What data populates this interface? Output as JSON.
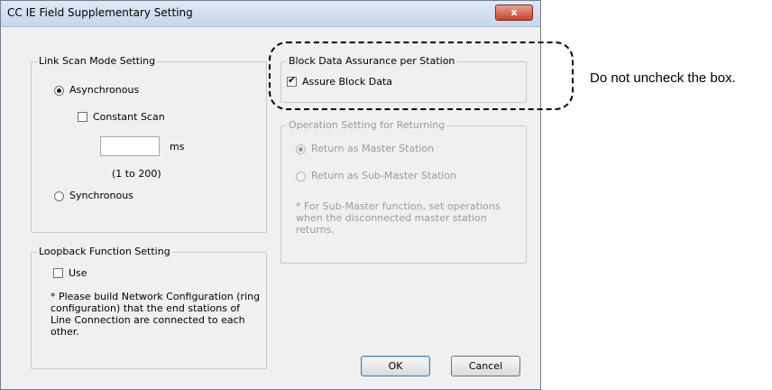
{
  "window": {
    "title": "CC IE Field Supplementary Setting",
    "close_label": "x"
  },
  "link_scan": {
    "legend": "Link Scan Mode Setting",
    "asynchronous_label": "Asynchronous",
    "asynchronous_selected": true,
    "constant_scan_label": "Constant Scan",
    "constant_scan_checked": false,
    "ms_value": "",
    "ms_unit": "ms",
    "range_hint": "(1 to 200)",
    "synchronous_label": "Synchronous"
  },
  "loopback": {
    "legend": "Loopback Function Setting",
    "use_label": "Use",
    "use_checked": false,
    "note": "* Please build Network Configuration (ring configuration) that the end stations of Line Connection are connected to each other."
  },
  "block_data": {
    "legend": "Block Data Assurance per Station",
    "assure_label": "Assure Block Data",
    "assure_checked": true
  },
  "operation_return": {
    "legend": "Operation Setting for Returning",
    "master_label": "Return as Master Station",
    "submaster_label": "Return as Sub-Master Station",
    "note": "* For Sub-Master function, set operations when the disconnected master station returns."
  },
  "buttons": {
    "ok": "OK",
    "cancel": "Cancel"
  },
  "callout": {
    "text": "Do not uncheck the box."
  }
}
